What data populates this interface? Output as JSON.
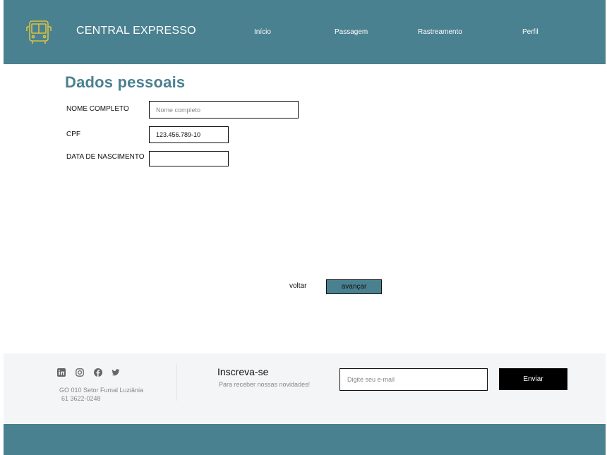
{
  "header": {
    "brand": "CENTRAL EXPRESSO",
    "logo_icon": "bus-icon",
    "nav": {
      "inicio": "Início",
      "passagem": "Passagem",
      "rastreamento": "Rastreamento",
      "perfil": "Perfil"
    }
  },
  "form": {
    "title": "Dados pessoais",
    "nome": {
      "label": "NOME COMPLETO",
      "placeholder": "Nome completo",
      "value": ""
    },
    "cpf": {
      "label": "CPF",
      "placeholder": "",
      "value": "123.456.789-10"
    },
    "data_nascimento": {
      "label": "DATA DE NASCIMENTO",
      "value": ""
    },
    "back_label": "voltar",
    "next_label": "avançar"
  },
  "footer": {
    "social_icons": [
      "linkedin-icon",
      "instagram-icon",
      "facebook-icon",
      "twitter-icon"
    ],
    "address": "GO 010 Setor Fumal Luziânia",
    "phone": "61 3622-0248",
    "subscribe_title": "Inscreva-se",
    "subscribe_subtitle": "Para receber nossas novidades!",
    "email_placeholder": "Digite seu e-mail",
    "send_label": "Enviar"
  },
  "colors": {
    "brand_teal": "#4a8190",
    "logo_yellow": "#d9c243",
    "footer_bg": "#f4f5f7",
    "button_dark": "#000000"
  }
}
